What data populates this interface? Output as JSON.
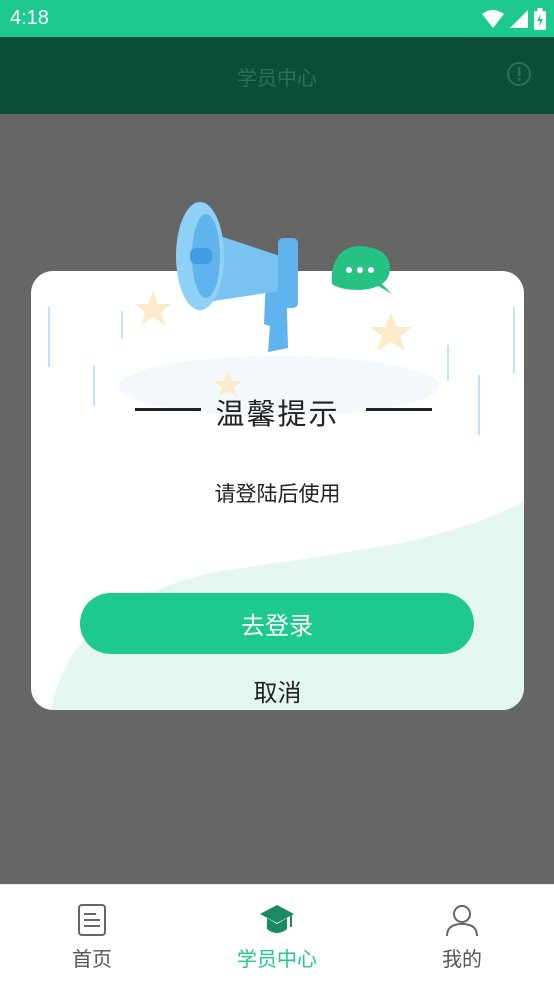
{
  "status_bar": {
    "time": "4:18"
  },
  "header": {
    "title": "学员中心"
  },
  "dialog": {
    "title": "温馨提示",
    "message": "请登陆后使用",
    "confirm_label": "去登录",
    "cancel_label": "取消"
  },
  "bottom_nav": {
    "items": [
      {
        "label": "首页",
        "icon": "document-icon",
        "active": false
      },
      {
        "label": "学员中心",
        "icon": "graduation-cap-icon",
        "active": true
      },
      {
        "label": "我的",
        "icon": "person-icon",
        "active": false
      }
    ]
  },
  "colors": {
    "accent": "#1ec98f",
    "header_bg": "#0d4e38",
    "overlay": "#666666"
  }
}
